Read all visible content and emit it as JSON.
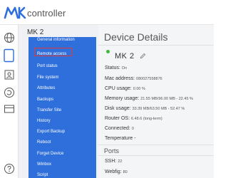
{
  "app": {
    "logo_text": "controller"
  },
  "rail": {
    "icons": [
      "globe-icon",
      "device-icon",
      "user-profile-icon",
      "refresh-icon",
      "card-icon",
      "help-icon"
    ]
  },
  "device": {
    "sidebar_title": "MK 2",
    "menu": [
      "General information",
      "Remote access",
      "Port status",
      "File system",
      "Attributes",
      "Backups",
      "Transfer Site",
      "History",
      "Export Backup",
      "Reboot",
      "Forget Device",
      "Winbox",
      "Script"
    ]
  },
  "main": {
    "title": "Device Details",
    "device_name": "MK 2",
    "details": [
      {
        "label": "Status:",
        "value": "On"
      },
      {
        "label": "Mac address:",
        "value": "080027558876"
      },
      {
        "label": "CPU usage:",
        "value": "0.00 %"
      },
      {
        "label": "Memory usage:",
        "value": "21.55 MB/96.00 MB - 22.45 %"
      },
      {
        "label": "Disk usage:",
        "value": "33.39 MB/63.50 MB - 52.47 %"
      },
      {
        "label": "Router OS:",
        "value": "6.48.6 (long-term)"
      },
      {
        "label": "Connected:",
        "value": "0"
      },
      {
        "label": "Temperature -",
        "value": ""
      }
    ],
    "ports_title": "Ports",
    "ports": [
      {
        "label": "SSH:",
        "value": "22"
      },
      {
        "label": "Webfig:",
        "value": "80"
      }
    ]
  },
  "colors": {
    "menu_bg": "#2f6fdc",
    "highlight_border": "#e53935",
    "status_online": "#3cb83c",
    "brand": "#2f6fdc"
  }
}
